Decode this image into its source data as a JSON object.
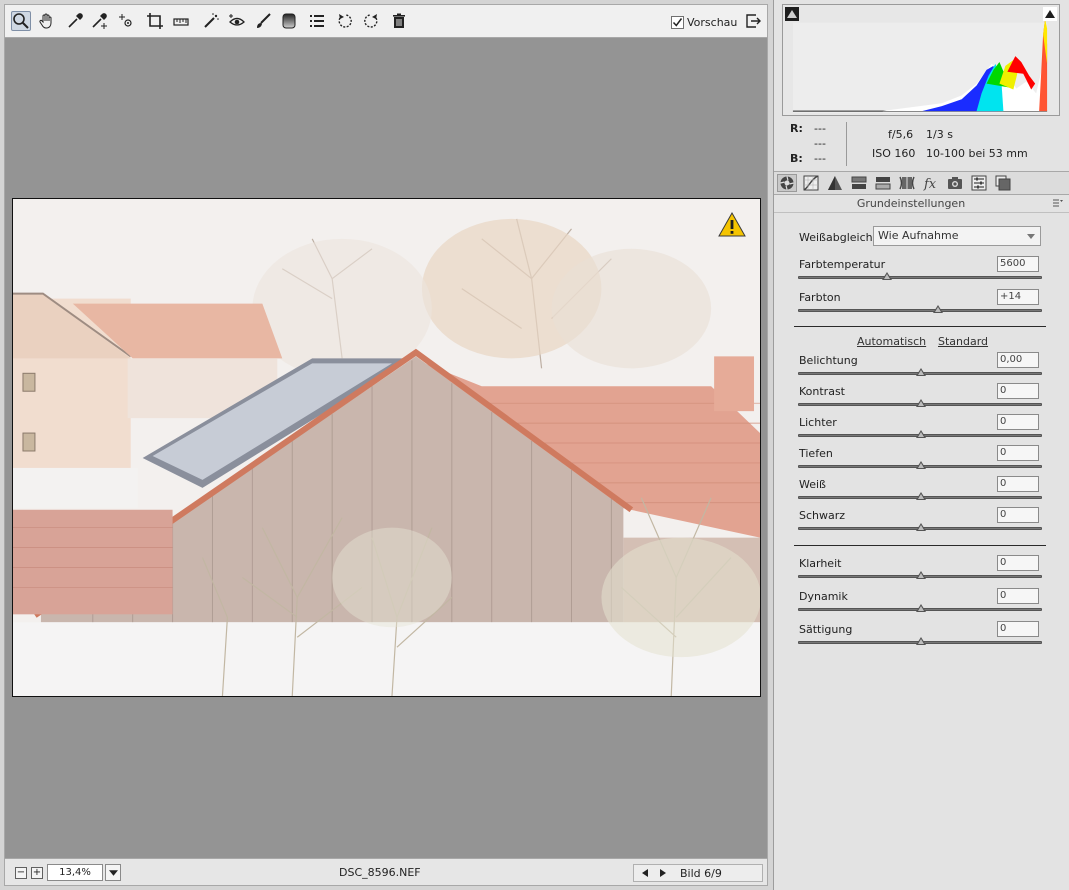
{
  "toolbar": {
    "tools": [
      {
        "icon": "zoom-icon",
        "active": true
      },
      {
        "icon": "hand-icon"
      },
      {
        "icon": "white-balance-eyedropper-icon"
      },
      {
        "icon": "color-sampler-icon"
      },
      {
        "icon": "targeted-adjustment-icon"
      },
      {
        "icon": "crop-icon"
      },
      {
        "icon": "straighten-icon"
      },
      {
        "icon": "spot-removal-icon"
      },
      {
        "icon": "red-eye-icon"
      },
      {
        "icon": "adjustment-brush-icon"
      },
      {
        "icon": "graduated-filter-icon"
      },
      {
        "icon": "preferences-icon"
      },
      {
        "icon": "rotate-left-icon"
      },
      {
        "icon": "rotate-right-icon"
      },
      {
        "icon": "trash-icon"
      }
    ],
    "preview_label": "Vorschau",
    "preview_checked": true
  },
  "photo": {
    "alt_description_hidden": "",
    "clipping_warning": true
  },
  "statusbar": {
    "zoom_out": "−",
    "zoom_in": "+",
    "zoom_value": "13,4%",
    "filename": "DSC_8596.NEF",
    "image_count": "Bild 6/9"
  },
  "histogram": {
    "colors": {
      "red": "#ff0000",
      "green": "#00e000",
      "blue": "#0014ff",
      "yellow": "#f2f200",
      "cyan": "#00e8f0",
      "white": "#ffffff"
    }
  },
  "info": {
    "r_label": "R:",
    "r_value": "---",
    "g_value": "---",
    "b_label": "B:",
    "b_value": "---",
    "aperture": "f/5,6",
    "shutter": "1/3 s",
    "iso": "ISO 160",
    "lens": "10-100 bei 53 mm"
  },
  "tabs": [
    {
      "icon": "basic-settings-icon",
      "selected": true
    },
    {
      "icon": "tone-curve-icon"
    },
    {
      "icon": "detail-icon"
    },
    {
      "icon": "hsl-icon"
    },
    {
      "icon": "split-toning-icon"
    },
    {
      "icon": "lens-corrections-icon"
    },
    {
      "icon": "effects-icon"
    },
    {
      "icon": "camera-calibration-icon"
    },
    {
      "icon": "presets-icon"
    },
    {
      "icon": "snapshots-icon"
    }
  ],
  "panel": {
    "title": "Grundeinstellungen",
    "white_balance_label": "Weißabgleich:",
    "white_balance_value": "Wie Aufnahme",
    "auto_label": "Automatisch",
    "default_label": "Standard",
    "sliders": [
      {
        "key": "temp",
        "label": "Farbtemperatur",
        "value": "5600",
        "position": 0.36
      },
      {
        "key": "tint",
        "label": "Farbton",
        "value": "+14",
        "position": 0.57
      },
      {
        "key": "exposure",
        "label": "Belichtung",
        "value": "0,00",
        "position": 0.5
      },
      {
        "key": "contrast",
        "label": "Kontrast",
        "value": "0",
        "position": 0.5
      },
      {
        "key": "highlights",
        "label": "Lichter",
        "value": "0",
        "position": 0.5
      },
      {
        "key": "shadows",
        "label": "Tiefen",
        "value": "0",
        "position": 0.5
      },
      {
        "key": "whites",
        "label": "Weiß",
        "value": "0",
        "position": 0.5
      },
      {
        "key": "blacks",
        "label": "Schwarz",
        "value": "0",
        "position": 0.5
      },
      {
        "key": "clarity",
        "label": "Klarheit",
        "value": "0",
        "position": 0.5
      },
      {
        "key": "vibrance",
        "label": "Dynamik",
        "value": "0",
        "position": 0.5
      },
      {
        "key": "saturation",
        "label": "Sättigung",
        "value": "0",
        "position": 0.5
      }
    ]
  }
}
